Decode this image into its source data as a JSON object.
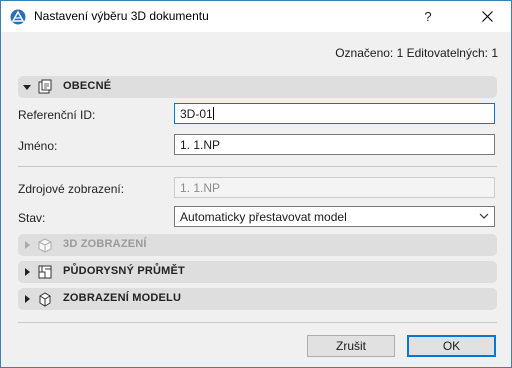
{
  "window": {
    "title": "Nastavení výběru 3D dokumentu",
    "help_label": "?"
  },
  "selection_info": "Označeno: 1 Editovatelných: 1",
  "sections": {
    "general": {
      "label": "OBECNÉ",
      "icon": "document-settings-icon"
    },
    "view3d": {
      "label": "3D ZOBRAZENÍ",
      "icon": "3d-box-icon"
    },
    "floor_plan": {
      "label": "PŮDORYSNÝ PRŮMĚT",
      "icon": "floor-plan-icon"
    },
    "model_view": {
      "label": "ZOBRAZENÍ MODELU",
      "icon": "model-cube-icon"
    }
  },
  "fields": {
    "reference_id": {
      "label": "Referenční ID:",
      "value": "3D-01"
    },
    "name": {
      "label": "Jméno:",
      "value": "1. 1.NP"
    },
    "source_view": {
      "label": "Zdrojové zobrazení:",
      "value": "1. 1.NP"
    },
    "status": {
      "label": "Stav:",
      "value": "Automaticky přestavovat model"
    }
  },
  "buttons": {
    "cancel": "Zrušit",
    "ok": "OK"
  },
  "colors": {
    "accent": "#0078d7",
    "section_bg": "#dedede",
    "dialog_bg": "#f0f0f0"
  }
}
